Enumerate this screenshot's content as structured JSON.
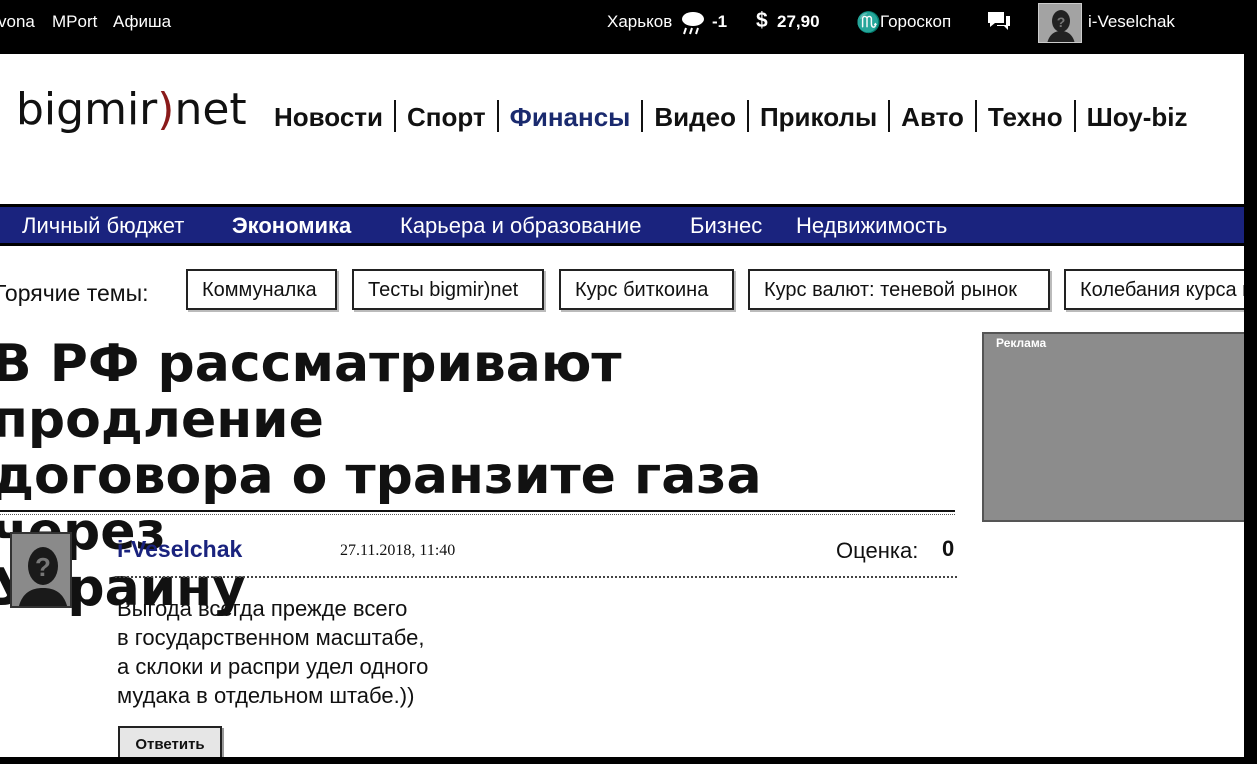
{
  "topbar": {
    "links": [
      "vona",
      "MPort",
      "Афиша"
    ],
    "city": "Харьков",
    "temperature": "-1",
    "currency_symbol": "$",
    "rate": "27,90",
    "zodiac": "♏",
    "horoscope": "Гороскоп",
    "username": "i-Veselchak"
  },
  "logo": {
    "part1": "bigmir",
    "paren": ")",
    "part2": "net"
  },
  "main_nav": {
    "items": [
      "Новости",
      "Спорт",
      "Финансы",
      "Видео",
      "Приколы",
      "Авто",
      "Техно",
      "Шоу-biz"
    ],
    "active": "Финансы"
  },
  "sub_nav": {
    "items": [
      "Личный бюджет",
      "Экономика",
      "Карьера и образование",
      "Бизнес",
      "Недвижимость"
    ],
    "active": "Экономика"
  },
  "hot_topics": {
    "label": "Горячие темы:",
    "chips": [
      "Коммуналка",
      "Тесты bigmir)net",
      "Курс биткоина",
      "Курс валют: теневой рынок",
      "Колебания курса г"
    ]
  },
  "article": {
    "headline_lines": [
      "В РФ рассматривают продление",
      "договора о транзите газа через",
      "Украину"
    ]
  },
  "ad": {
    "label": "Реклама"
  },
  "comment": {
    "author": "i-Veselchak",
    "date": "27.11.2018, 11:40",
    "score_label": "Оценка:",
    "score": "0",
    "text_lines": [
      "Выгода всегда прежде всего",
      "в государственном масштабе,",
      "а склоки и распри удел одного",
      "мудака в отдельном штабе.))"
    ],
    "reply_label": "Ответить"
  },
  "colors": {
    "nav_blue": "#1a237e",
    "logo_paren": "#8a1a1a",
    "active_nav": "#1a2a6e"
  }
}
